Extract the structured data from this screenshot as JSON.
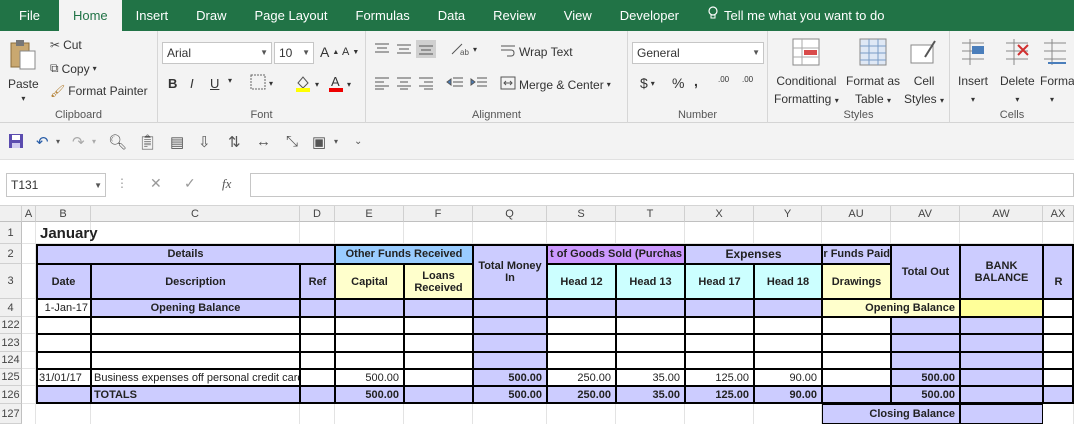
{
  "ribbon_tabs": [
    "File",
    "Home",
    "Insert",
    "Draw",
    "Page Layout",
    "Formulas",
    "Data",
    "Review",
    "View",
    "Developer"
  ],
  "tell_me": "Tell me what you want to do",
  "clipboard": {
    "paste": "Paste",
    "cut": "Cut",
    "copy": "Copy",
    "format_painter": "Format Painter",
    "label": "Clipboard"
  },
  "font": {
    "name": "Arial",
    "size": "10",
    "bold": "B",
    "italic": "I",
    "underline": "U",
    "grow": "A",
    "shrink": "A",
    "label": "Font"
  },
  "alignment": {
    "wrap": "Wrap Text",
    "merge": "Merge & Center",
    "label": "Alignment"
  },
  "number": {
    "format": "General",
    "currency": "$",
    "percent": "%",
    "comma": ",",
    "inc_dec": ".00",
    "label": "Number"
  },
  "styles": {
    "conditional": "Conditional",
    "conditional2": "Formatting",
    "format_as": "Format as",
    "format_as2": "Table",
    "cell": "Cell",
    "cell2": "Styles",
    "label": "Styles"
  },
  "cells": {
    "insert": "Insert",
    "delete": "Delete",
    "format": "Forma",
    "label": "Cells"
  },
  "name_box": "T131",
  "fx": "fx",
  "col_headers": [
    "A",
    "B",
    "C",
    "D",
    "E",
    "F",
    "Q",
    "S",
    "T",
    "X",
    "Y",
    "AU",
    "AV",
    "AW",
    "AX"
  ],
  "row_headers": [
    "1",
    "2",
    "3",
    "4",
    "122",
    "123",
    "124",
    "125",
    "126",
    "127"
  ],
  "sheet": {
    "title": "January",
    "details": "Details",
    "other_funds": "Other Funds Received",
    "total_money_in": "Total Money In",
    "cogs": "t of Goods Sold (Purchas",
    "expenses": "Expenses",
    "funds_paid": "r Funds Paid",
    "total_out": "Total Out",
    "bank_balance": "BANK BALANCE",
    "date": "Date",
    "description": "Description",
    "ref": "Ref",
    "capital": "Capital",
    "loans": "Loans Received",
    "head12": "Head 12",
    "head13": "Head 13",
    "head17": "Head 17",
    "head18": "Head 18",
    "drawings": "Drawings",
    "r": "R",
    "r4_date": "1-Jan-17",
    "r4_desc": "Opening Balance",
    "r4_ob": "Opening Balance",
    "r125_date": "31/01/17",
    "r125_desc": "Business expenses off personal credit card",
    "r125_capital": "500.00",
    "r125_money_in": "500.00",
    "r125_h12": "250.00",
    "r125_h13": "35.00",
    "r125_h17": "125.00",
    "r125_h18": "90.00",
    "r125_total_out": "500.00",
    "totals": "TOTALS",
    "t_capital": "500.00",
    "t_money_in": "500.00",
    "t_h12": "250.00",
    "t_h13": "35.00",
    "t_h17": "125.00",
    "t_h18": "90.00",
    "t_total_out": "500.00",
    "closing_balance": "Closing Balance"
  }
}
